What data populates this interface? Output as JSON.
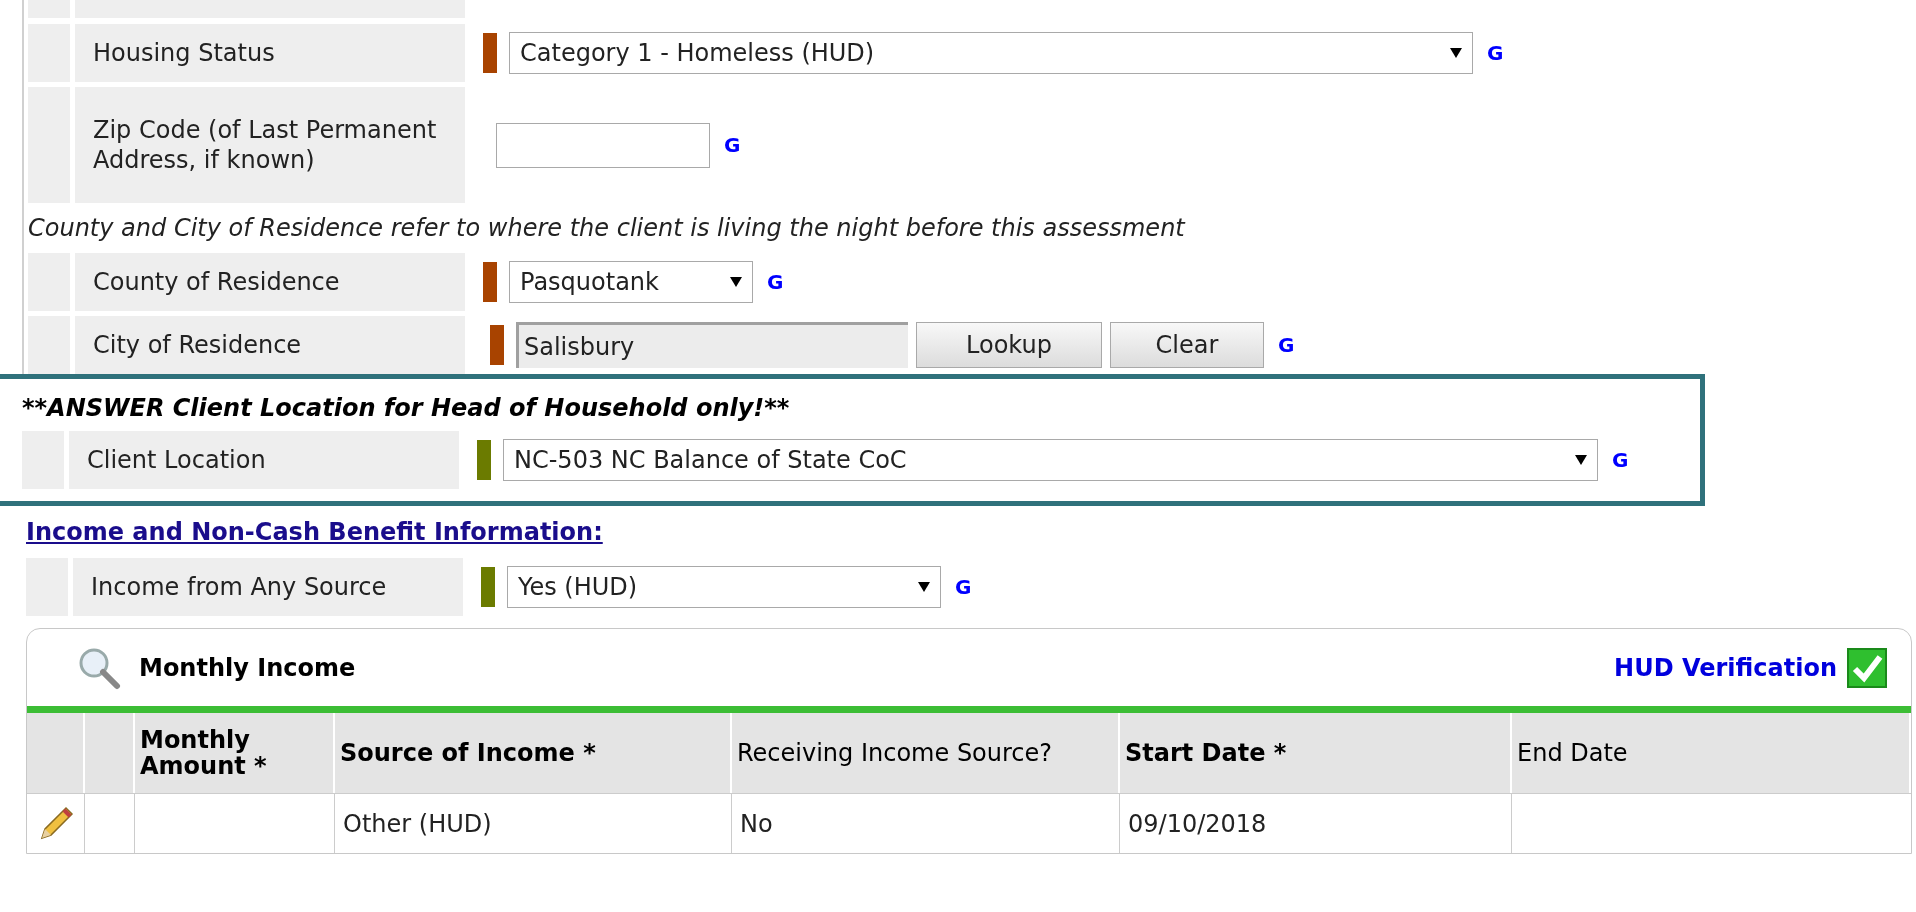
{
  "fields": [
    {
      "label": "Housing Status",
      "color": "#a84300",
      "control": {
        "kind": "select",
        "value": "Category 1 - Homeless (HUD)"
      },
      "g": "G"
    },
    {
      "label": "Zip Code (of Last Permanent Address, if known)",
      "control": {
        "kind": "text"
      },
      "g": "G"
    }
  ],
  "note": "County and City of Residence refer to where the client is living the night before this assessment",
  "residence_fields": [
    {
      "label": "County of Residence",
      "color": "#a84300",
      "control": {
        "kind": "select",
        "value": "Pasquotank"
      },
      "g": "G"
    },
    {
      "label": "City of Residence",
      "color": "#a84300",
      "control": {
        "kind": "lookup",
        "value": "Salisbury",
        "buttons": [
          "Lookup",
          "Clear"
        ]
      },
      "g": "G"
    }
  ],
  "highlight": {
    "heading": "**ANSWER Client Location for Head of Household only!**",
    "field": {
      "label": "Client Location",
      "color": "#6b7b00",
      "control": {
        "kind": "select",
        "value": "NC-503 NC Balance of State CoC"
      },
      "g": "G"
    }
  },
  "section_link": "Income and Non-Cash Benefit Information:",
  "income_field": {
    "label": "Income from Any Source",
    "color": "#6b7b00",
    "control": {
      "kind": "select",
      "value": "Yes (HUD)"
    },
    "g": "G"
  },
  "panel": {
    "title": "Monthly Income",
    "verification": "HUD Verification",
    "verified": true,
    "columns": [
      {
        "label": "Monthly Amount",
        "mark": "*"
      },
      {
        "label": "Source of Income",
        "mark": "*"
      },
      {
        "label": "Receiving Income Source?"
      },
      {
        "label": "Start Date",
        "mark": "*"
      },
      {
        "label": "End Date"
      }
    ],
    "rows": [
      {
        "source": "Other (HUD)",
        "receiving": "No",
        "start_date": "09/10/2018"
      }
    ]
  }
}
